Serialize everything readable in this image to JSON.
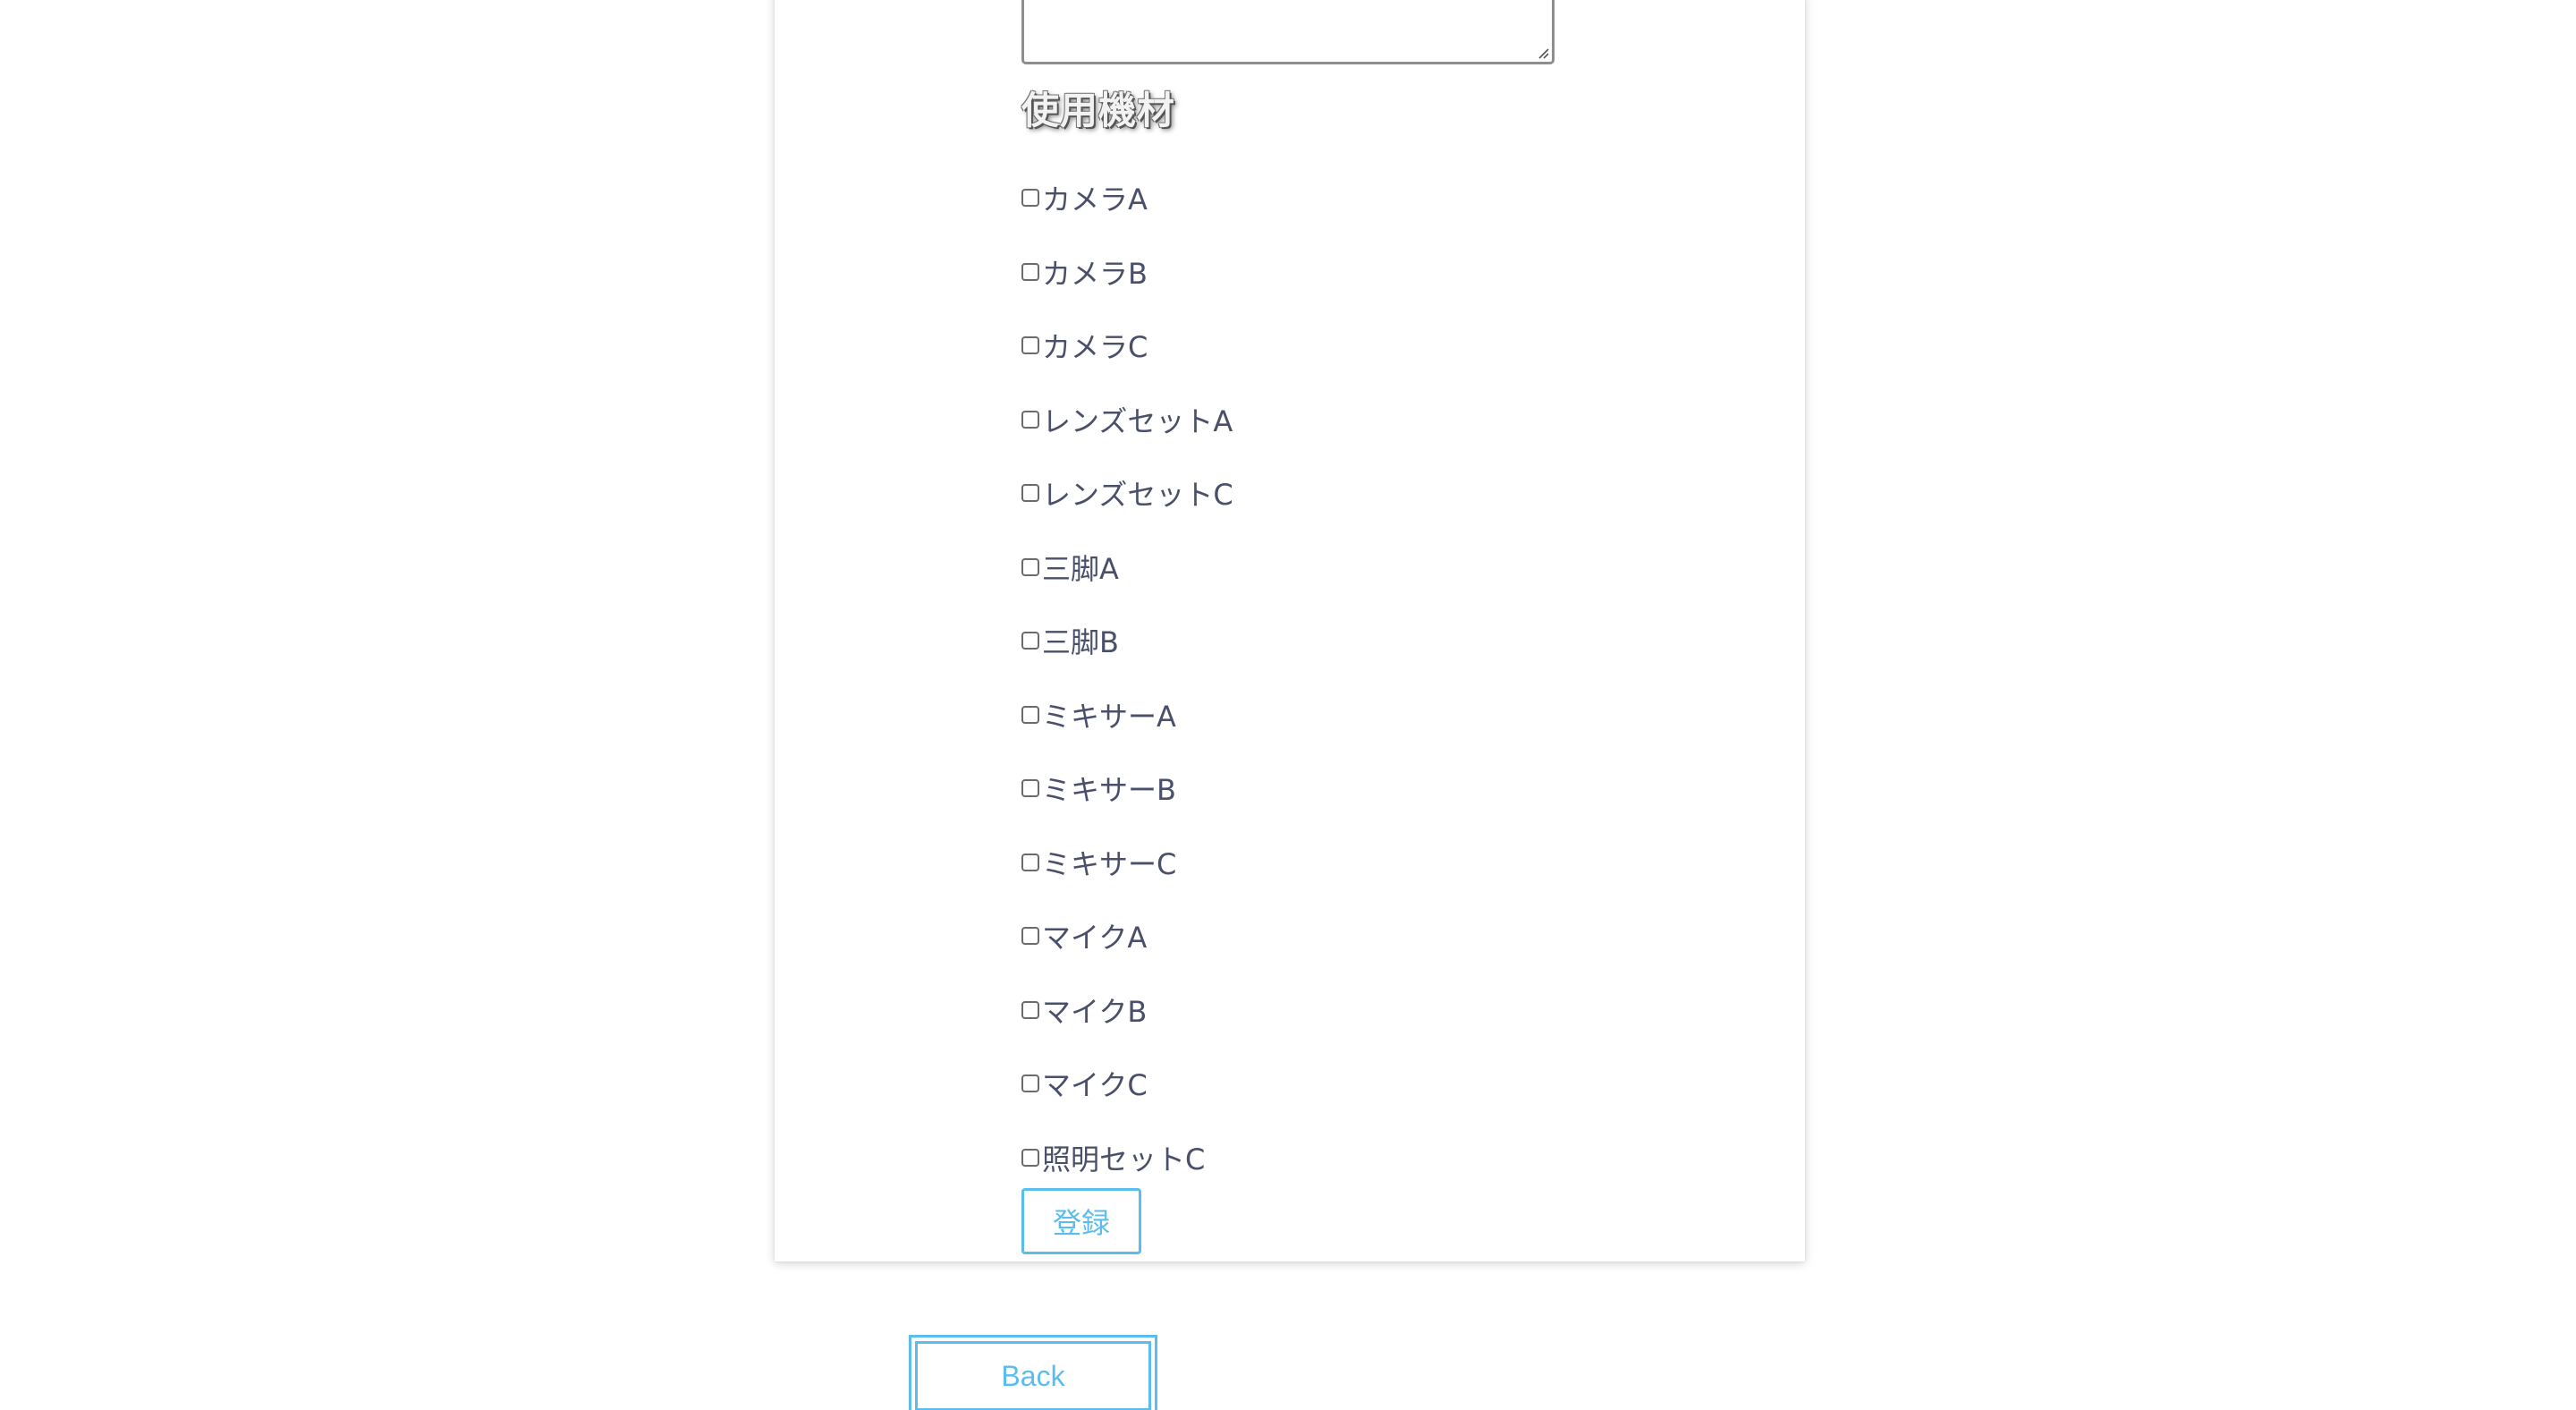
{
  "form": {
    "notes_value": "",
    "section_title": "使用機材",
    "equipment": [
      {
        "label": "カメラA",
        "checked": false
      },
      {
        "label": "カメラB",
        "checked": false
      },
      {
        "label": "カメラC",
        "checked": false
      },
      {
        "label": "レンズセットA",
        "checked": false
      },
      {
        "label": "レンズセットC",
        "checked": false
      },
      {
        "label": "三脚A",
        "checked": false
      },
      {
        "label": "三脚B",
        "checked": false
      },
      {
        "label": "ミキサーA",
        "checked": false
      },
      {
        "label": "ミキサーB",
        "checked": false
      },
      {
        "label": "ミキサーC",
        "checked": false
      },
      {
        "label": "マイクA",
        "checked": false
      },
      {
        "label": "マイクB",
        "checked": false
      },
      {
        "label": "マイクC",
        "checked": false
      },
      {
        "label": "照明セットC",
        "checked": false
      }
    ],
    "submit_label": "登録"
  },
  "nav": {
    "back_label": "Back"
  },
  "colors": {
    "accent": "#5bbdee",
    "text": "#4a4f6a",
    "checkbox_border": "#6b6b6b",
    "background": "#ffffff"
  }
}
